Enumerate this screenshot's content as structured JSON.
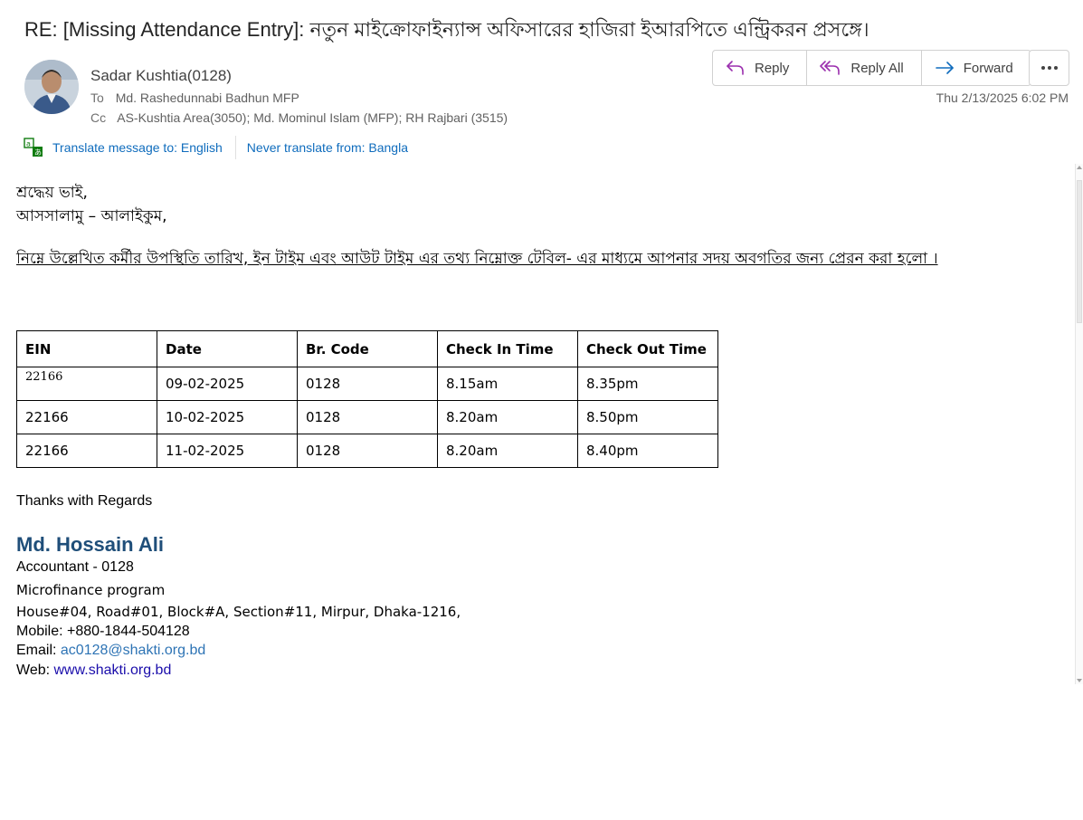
{
  "message": {
    "subject": "RE: [Missing Attendance Entry]: নতুন মাইক্রোফাইন্যান্স অফিসারের  হাজিরা ইআরপিতে এন্ট্রিকরন প্রসঙ্গে।",
    "sender": "Sadar Kushtia(0128)",
    "to_label": "To",
    "to": "Md. Rashedunnabi Badhun MFP",
    "cc_label": "Cc",
    "cc": "AS-Kushtia Area(3050); Md. Mominul Islam (MFP); RH Rajbari (3515)",
    "date": "Thu 2/13/2025 6:02 PM"
  },
  "actions": {
    "reply": "Reply",
    "reply_all": "Reply All",
    "forward": "Forward"
  },
  "translate": {
    "translate_link": "Translate message to: English",
    "never_link": "Never translate from: Bangla"
  },
  "body": {
    "greeting": "শ্রদ্ধেয়  ভাই,",
    "salam": "আসসালামু  –  আলাইকুম,",
    "paragraph": "নিম্নে উল্লেখিত কর্মীর  উপস্থিতি তারিখ, ইন টাইম এবং আউট টাইম এর তথ্য নিম্নোক্ত টেবিল- এর মাধ্যমে আপনার সদয় অবগতির জন্য প্রেরন করা হলো ।"
  },
  "table": {
    "headers": [
      "EIN",
      "Date",
      "Br. Code",
      "Check In Time",
      "Check Out Time"
    ],
    "rows": [
      [
        "22166",
        "09-02-2025",
        "0128",
        "8.15am",
        "8.35pm"
      ],
      [
        "22166",
        "10-02-2025",
        "0128",
        "8.20am",
        "8.50pm"
      ],
      [
        "22166",
        "11-02-2025",
        "0128",
        "8.20am",
        "8.40pm"
      ]
    ]
  },
  "signature": {
    "thanks": "Thanks with Regards",
    "name": "Md. Hossain Ali",
    "title": "Accountant - 0128",
    "program": "Microfinance program",
    "address": "House#04, Road#01, Block#A, Section#11, Mirpur, Dhaka-1216,",
    "mobile": "Mobile: +880-1844-504128",
    "email_label": "Email: ",
    "email": "ac0128@shakti.org.bd",
    "web_label": "Web: ",
    "web": "www.shakti.org.bd"
  },
  "colors": {
    "link": "#0f6cbd",
    "signature_name": "#1f4e79",
    "reply_icon": "#9b2fae",
    "forward_icon": "#0f6cbd",
    "translate_icon": "#107c10"
  },
  "icons": {
    "reply": "reply-arrow-icon",
    "reply_all": "reply-all-arrow-icon",
    "forward": "forward-arrow-icon",
    "more": "more-horizontal-icon",
    "translate": "translate-icon"
  }
}
